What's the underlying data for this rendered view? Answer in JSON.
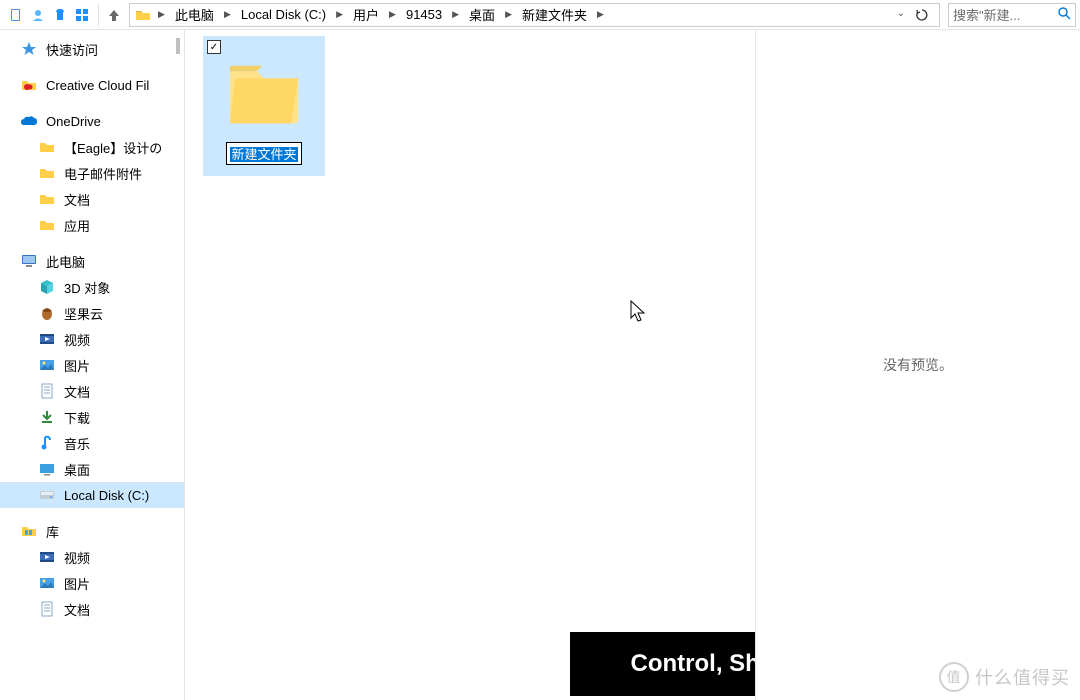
{
  "toolbar": {
    "quick_icons": [
      "new-file-icon",
      "person-icon",
      "shirt-icon",
      "grid-icon"
    ]
  },
  "breadcrumb": {
    "items": [
      "此电脑",
      "Local Disk (C:)",
      "用户",
      "91453",
      "桌面",
      "新建文件夹"
    ]
  },
  "search": {
    "placeholder": "搜索\"新建..."
  },
  "sidebar": {
    "quick_access": "快速访问",
    "creative_cloud": "Creative Cloud Fil",
    "onedrive": "OneDrive",
    "onedrive_children": [
      {
        "label": "【Eagle】设计の",
        "icon": "folder"
      },
      {
        "label": "电子邮件附件",
        "icon": "folder"
      },
      {
        "label": "文档",
        "icon": "folder"
      },
      {
        "label": "应用",
        "icon": "folder"
      }
    ],
    "this_pc": "此电脑",
    "this_pc_children": [
      {
        "label": "3D 对象",
        "icon": "cube"
      },
      {
        "label": "坚果云",
        "icon": "nut"
      },
      {
        "label": "视频",
        "icon": "video"
      },
      {
        "label": "图片",
        "icon": "pictures"
      },
      {
        "label": "文档",
        "icon": "docs"
      },
      {
        "label": "下载",
        "icon": "downloads"
      },
      {
        "label": "音乐",
        "icon": "music"
      },
      {
        "label": "桌面",
        "icon": "desktop"
      },
      {
        "label": "Local Disk (C:)",
        "icon": "disk",
        "selected": true
      }
    ],
    "libraries": "库",
    "libraries_children": [
      {
        "label": "视频",
        "icon": "video-lib"
      },
      {
        "label": "图片",
        "icon": "pictures-lib"
      },
      {
        "label": "文档",
        "icon": "docs-lib"
      }
    ]
  },
  "content": {
    "folder_name": "新建文件夹",
    "checkbox_checked": true
  },
  "preview": {
    "empty_text": "没有预览。"
  },
  "overlay": {
    "hotkey": "Control, Shift + n"
  },
  "watermark": {
    "glyph": "值",
    "text": "什么值得买"
  }
}
